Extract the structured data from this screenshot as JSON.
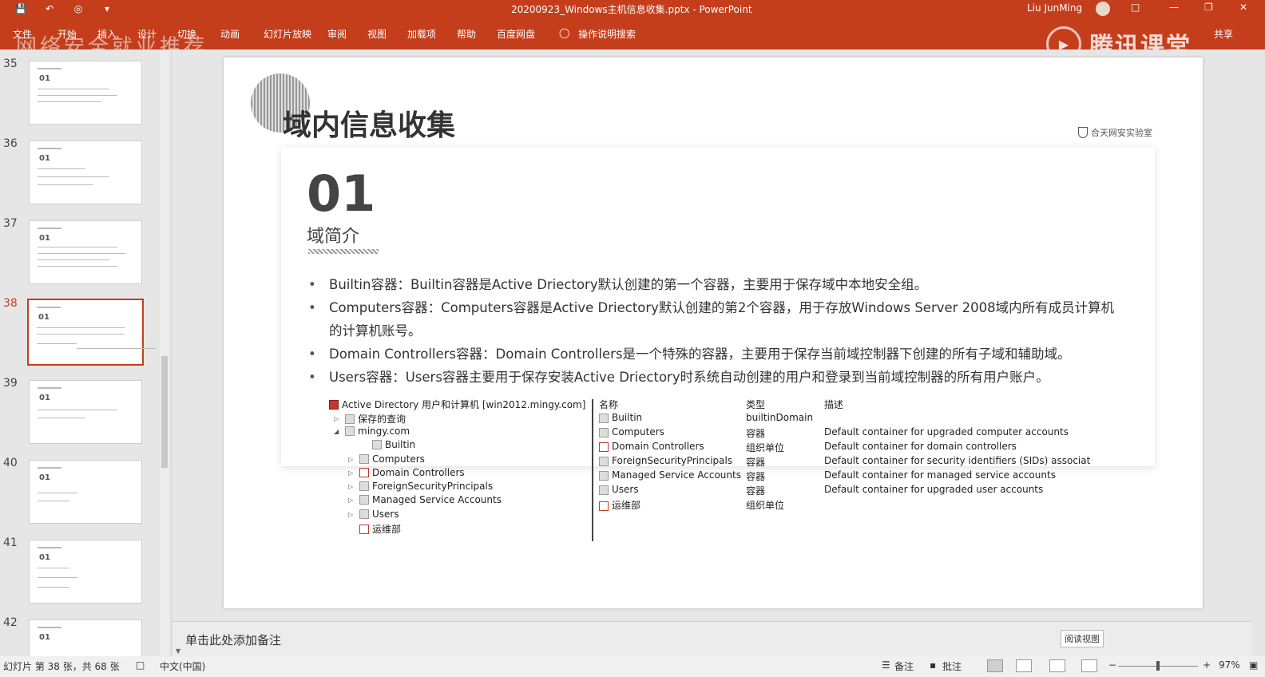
{
  "window": {
    "title": "20200923_Windows主机信息收集.pptx - PowerPoint",
    "user": "Liu JunMing"
  },
  "ribbon": {
    "tabs": [
      "文件",
      "开始",
      "插入",
      "设计",
      "切换",
      "动画",
      "幻灯片放映",
      "审阅",
      "视图",
      "加载项",
      "帮助",
      "百度网盘",
      "操作说明搜索"
    ],
    "watermark_text": "网络安全就业推荐",
    "logo_text": "腾讯课堂",
    "share_label": "共享"
  },
  "thumbnails": {
    "numbers": [
      "35",
      "36",
      "37",
      "38",
      "39",
      "40",
      "41",
      "42"
    ],
    "active_number": "38"
  },
  "slide": {
    "title": "域内信息收集",
    "brand": "合天网安实验室",
    "number": "01",
    "subtitle": "域简介",
    "bullets": [
      "Builtin容器：Builtin容器是Active Driectory默认创建的第一个容器，主要用于保存域中本地安全组。",
      "Computers容器：Computers容器是Active Driectory默认创建的第2个容器，用于存放Windows Server 2008域内所有成员计算机的计算机账号。",
      "Domain Controllers容器：Domain Controllers是一个特殊的容器，主要用于保存当前域控制器下创建的所有子域和辅助域。",
      "Users容器：Users容器主要用于保存安装Active Driectory时系统自动创建的用户和登录到当前域控制器的所有用户账户。"
    ],
    "tree": {
      "root": "Active Directory 用户和计算机 [win2012.mingy.com]",
      "saved": "保存的查询",
      "domain": "mingy.com",
      "children": [
        "Builtin",
        "Computers",
        "Domain Controllers",
        "ForeignSecurityPrincipals",
        "Managed Service Accounts",
        "Users",
        "运维部"
      ]
    },
    "list": {
      "headers": [
        "名称",
        "类型",
        "描述"
      ],
      "rows": [
        {
          "name": "Builtin",
          "type": "builtinDomain",
          "desc": ""
        },
        {
          "name": "Computers",
          "type": "容器",
          "desc": "Default container for upgraded computer accounts"
        },
        {
          "name": "Domain Controllers",
          "type": "组织单位",
          "desc": "Default container for domain controllers"
        },
        {
          "name": "ForeignSecurityPrincipals",
          "type": "容器",
          "desc": "Default container for security identifiers (SIDs) associat"
        },
        {
          "name": "Managed Service Accounts",
          "type": "容器",
          "desc": "Default container for managed service accounts"
        },
        {
          "name": "Users",
          "type": "容器",
          "desc": "Default container for upgraded user accounts"
        },
        {
          "name": "运维部",
          "type": "组织单位",
          "desc": ""
        }
      ]
    }
  },
  "notes": {
    "placeholder": "单击此处添加备注",
    "reader_label": "阅读视图"
  },
  "status": {
    "slide_info": "幻灯片 第 38 张，共 68 张",
    "language": "中文(中国)",
    "notes_label": "备注",
    "comments_label": "批注",
    "zoom": "97%"
  },
  "colors": {
    "accent": "#c43e1c"
  }
}
